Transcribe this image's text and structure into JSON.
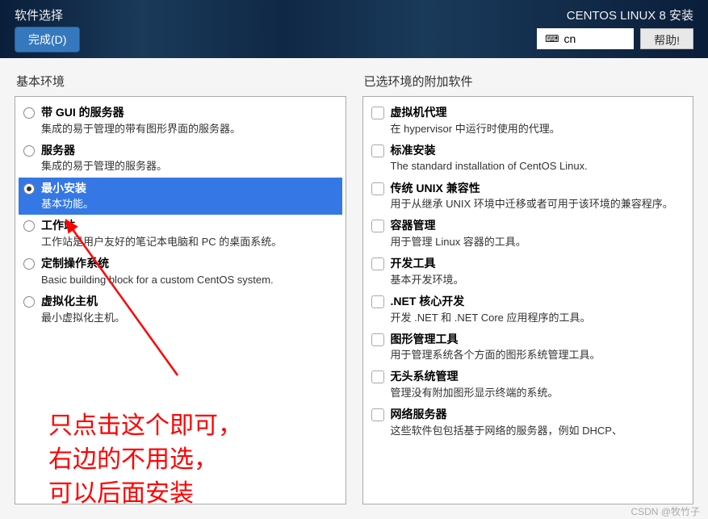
{
  "header": {
    "title": "软件选择",
    "done_label": "完成(D)",
    "install_title": "CENTOS LINUX 8 安装",
    "keyboard_layout": "cn",
    "help_label": "帮助!"
  },
  "left": {
    "heading": "基本环境",
    "selected_index": 2,
    "items": [
      {
        "title": "带 GUI 的服务器",
        "desc": "集成的易于管理的带有图形界面的服务器。"
      },
      {
        "title": "服务器",
        "desc": "集成的易于管理的服务器。"
      },
      {
        "title": "最小安装",
        "desc": "基本功能。"
      },
      {
        "title": "工作站",
        "desc": "工作站是用户友好的笔记本电脑和 PC 的桌面系统。"
      },
      {
        "title": "定制操作系统",
        "desc": "Basic building block for a custom CentOS system."
      },
      {
        "title": "虚拟化主机",
        "desc": "最小虚拟化主机。"
      }
    ]
  },
  "right": {
    "heading": "已选环境的附加软件",
    "items": [
      {
        "title": "虚拟机代理",
        "desc": "在 hypervisor 中运行时使用的代理。"
      },
      {
        "title": "标准安装",
        "desc": "The standard installation of CentOS Linux."
      },
      {
        "title": "传统 UNIX 兼容性",
        "desc": "用于从继承 UNIX 环境中迁移或者可用于该环境的兼容程序。"
      },
      {
        "title": "容器管理",
        "desc": "用于管理 Linux 容器的工具。"
      },
      {
        "title": "开发工具",
        "desc": "基本开发环境。"
      },
      {
        "title": ".NET 核心开发",
        "desc": "开发 .NET 和 .NET Core 应用程序的工具。"
      },
      {
        "title": "图形管理工具",
        "desc": "用于管理系统各个方面的图形系统管理工具。"
      },
      {
        "title": "无头系统管理",
        "desc": "管理没有附加图形显示终端的系统。"
      },
      {
        "title": "网络服务器",
        "desc": "这些软件包包括基于网络的服务器，例如 DHCP、"
      }
    ]
  },
  "annotation": {
    "line1": "只点击这个即可，",
    "line2": "右边的不用选，",
    "line3": "可以后面安装"
  },
  "watermark": "CSDN @牧竹子"
}
